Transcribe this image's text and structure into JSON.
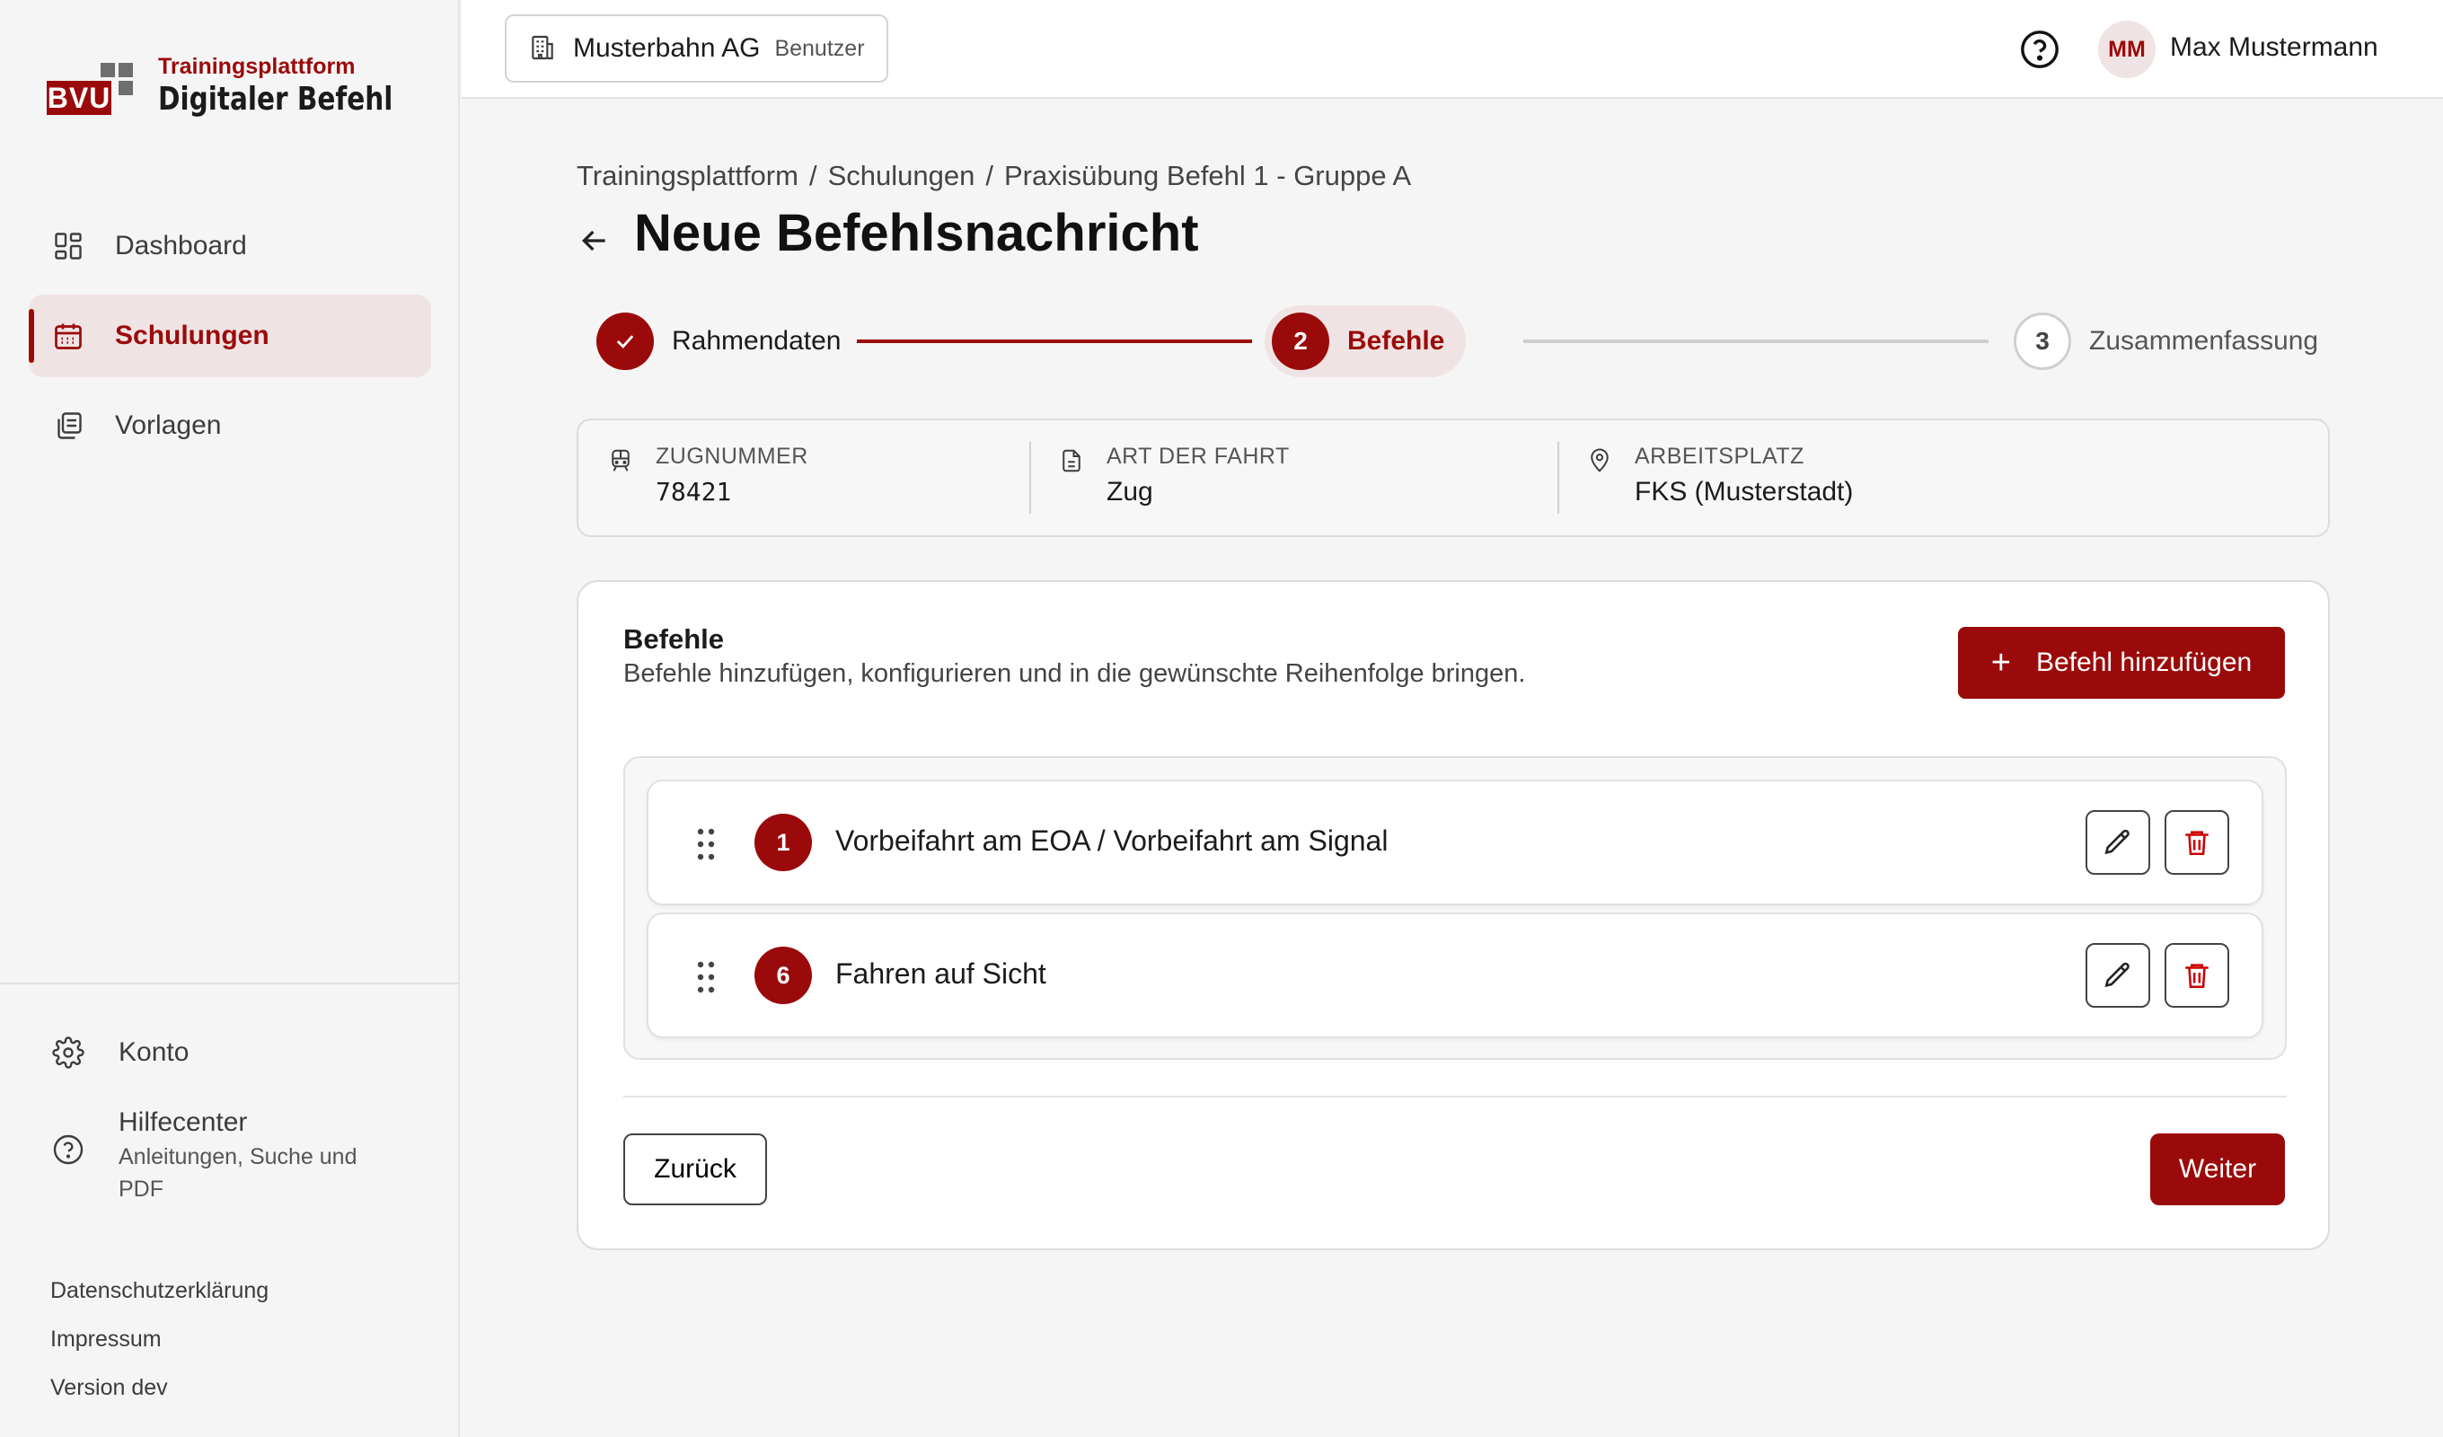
{
  "brand": {
    "logo_text": "BVU",
    "line1": "Trainingsplattform",
    "line2": "Digitaler Befehl",
    "accent": "#9b0a0a"
  },
  "sidebar": {
    "items": [
      {
        "label": "Dashboard",
        "icon": "dashboard-icon",
        "active": false
      },
      {
        "label": "Schulungen",
        "icon": "calendar-icon",
        "active": true
      },
      {
        "label": "Vorlagen",
        "icon": "templates-icon",
        "active": false
      }
    ],
    "konto": "Konto",
    "help_title": "Hilfecenter",
    "help_sub": "Anleitungen, Suche und PDF",
    "links": [
      "Datenschutzerklärung",
      "Impressum",
      "Version dev"
    ]
  },
  "topbar": {
    "org_name": "Musterbahn AG",
    "org_role": "Benutzer",
    "avatar_initials": "MM",
    "user_name": "Max Mustermann"
  },
  "breadcrumb": [
    "Trainingsplattform",
    "Schulungen",
    "Praxisübung Befehl 1 - Gruppe A"
  ],
  "page_title": "Neue Befehlsnachricht",
  "stepper": {
    "steps": [
      {
        "label": "Rahmendaten",
        "state": "done",
        "number": "1"
      },
      {
        "label": "Befehle",
        "state": "active",
        "number": "2"
      },
      {
        "label": "Zusammenfassung",
        "state": "todo",
        "number": "3"
      }
    ]
  },
  "info": {
    "train_label": "Zugnummer",
    "train_value": "78421",
    "trip_label": "Art der Fahrt",
    "trip_value": "Zug",
    "work_label": "Arbeitsplatz",
    "work_value": "FKS (Musterstadt)"
  },
  "befehle": {
    "title": "Befehle",
    "subtitle": "Befehle hinzufügen, konfigurieren und in die gewünschte Reihenfolge bringen.",
    "add_label": "Befehl hinzufügen",
    "items": [
      {
        "number": "1",
        "title": "Vorbeifahrt am EOA / Vorbeifahrt am Signal"
      },
      {
        "number": "6",
        "title": "Fahren auf Sicht"
      }
    ]
  },
  "actions": {
    "back_label": "Zurück",
    "next_label": "Weiter"
  }
}
